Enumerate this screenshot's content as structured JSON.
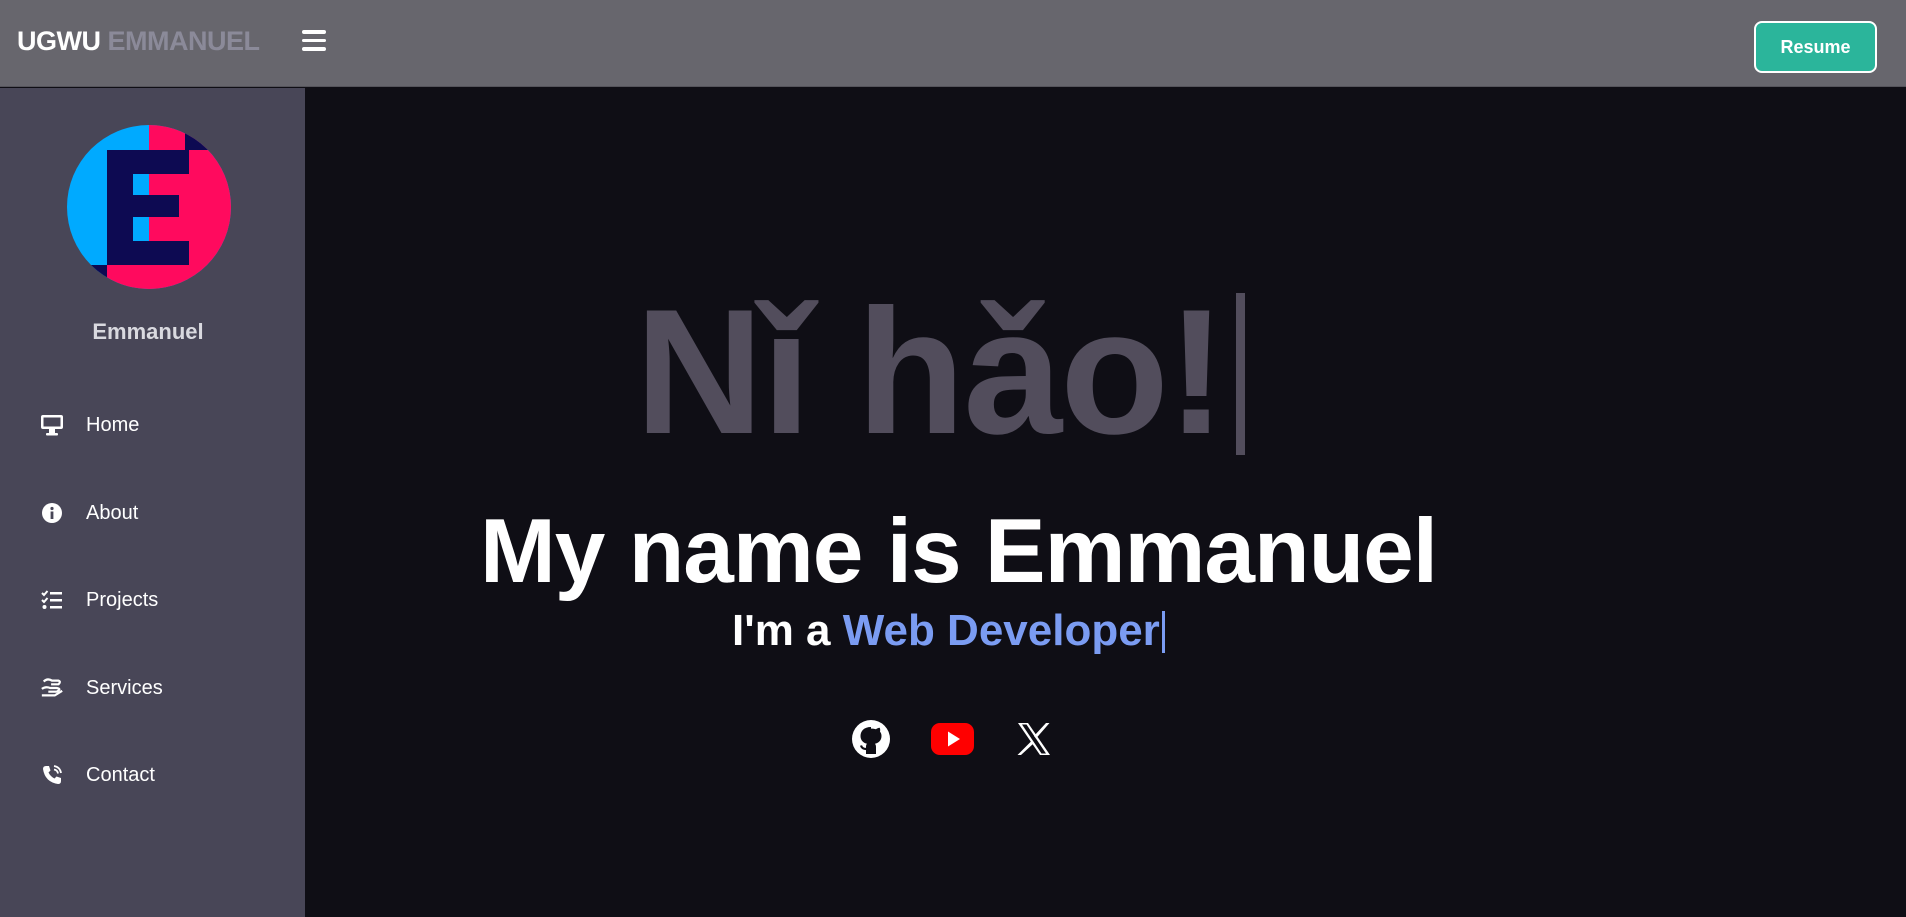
{
  "header": {
    "brand_first": "UGWU",
    "brand_last": "EMMANUEL",
    "menu_icon": "hamburger-menu-icon",
    "resume_label": "Resume"
  },
  "sidebar": {
    "avatar_letter": "E",
    "profile_name": "Emmanuel",
    "items": [
      {
        "label": "Home",
        "icon": "desktop-icon"
      },
      {
        "label": "About",
        "icon": "info-circle-icon"
      },
      {
        "label": "Projects",
        "icon": "task-list-icon"
      },
      {
        "label": "Services",
        "icon": "hand-holding-icon"
      },
      {
        "label": "Contact",
        "icon": "phone-volume-icon"
      }
    ]
  },
  "hero": {
    "greeting": "Nǐ hǎo!",
    "headline": "My name is Emmanuel",
    "sub_prefix": "I'm a ",
    "sub_role": "Web Developer"
  },
  "social": [
    {
      "name": "GitHub",
      "icon": "github-icon"
    },
    {
      "name": "YouTube",
      "icon": "youtube-icon"
    },
    {
      "name": "X",
      "icon": "x-twitter-icon"
    }
  ],
  "colors": {
    "topbar": "#67666d",
    "sidebar": "#484657",
    "main_bg": "#0f0e15",
    "accent_green": "#2bb59b",
    "role_blue": "#7b9cf2",
    "greeting_gray": "#524d5c",
    "youtube_red": "#ff0000"
  }
}
